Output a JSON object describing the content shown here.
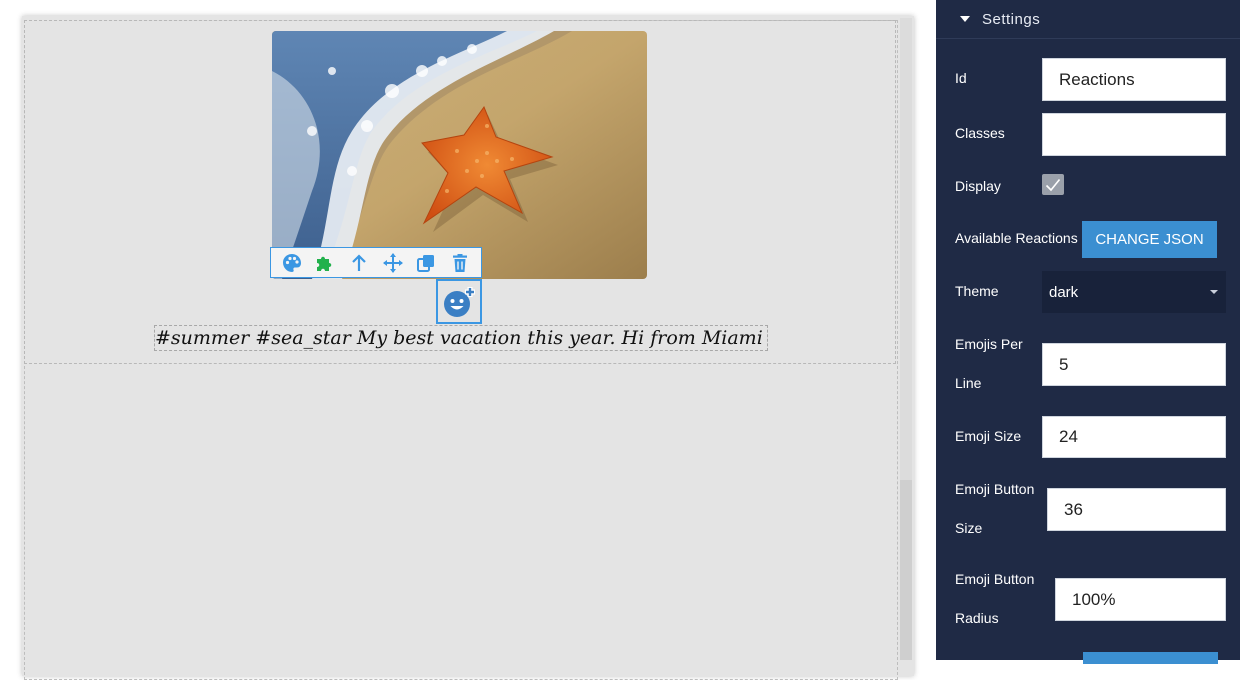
{
  "canvas": {
    "caption": "#summer #sea_star My best vacation this year. Hi from Miami :)",
    "toolbar": {
      "icons": [
        "palette-icon",
        "puzzle-icon",
        "arrow-up-icon",
        "move-icon",
        "copy-icon",
        "trash-icon"
      ]
    },
    "reaction_button_icon": "smiley-add-icon"
  },
  "panel": {
    "title": "Settings",
    "id_label": "Id",
    "id_value": "Reactions",
    "classes_label": "Classes",
    "classes_value": "",
    "display_label": "Display",
    "display_checked": true,
    "reactions_label": "Available Reactions",
    "change_json_label": "CHANGE JSON",
    "theme_label": "Theme",
    "theme_value": "dark",
    "emojis_per_line_label": [
      "Emojis Per",
      "Line"
    ],
    "emojis_per_line_value": "5",
    "emoji_size_label": "Emoji Size",
    "emoji_size_value": "24",
    "emoji_button_size_label": [
      "Emoji Button",
      "Size"
    ],
    "emoji_button_size_value": "36",
    "emoji_button_radius_label": [
      "Emoji Button",
      "Radius"
    ],
    "emoji_button_radius_value": "100%"
  },
  "colors": {
    "accent": "#3b97e3",
    "panel_bg": "#1f2a45",
    "button_blue": "#3b8fd1",
    "puzzle_green": "#22b14c"
  }
}
